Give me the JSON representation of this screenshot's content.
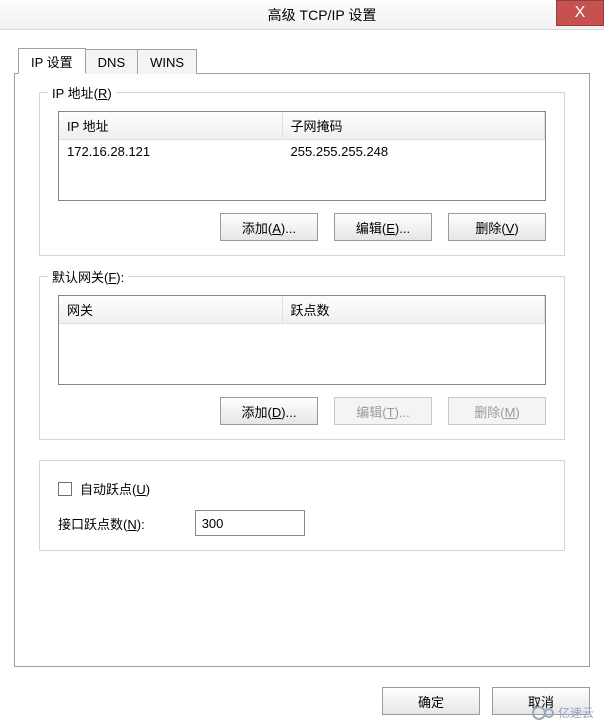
{
  "window": {
    "title": "高级 TCP/IP 设置",
    "close": "X"
  },
  "tabs": [
    "IP 设置",
    "DNS",
    "WINS"
  ],
  "ip_group": {
    "legend_pre": "IP 地址(",
    "legend_key": "R",
    "legend_post": ")",
    "cols": [
      "IP 地址",
      "子网掩码"
    ],
    "rows": [
      {
        "ip": "172.16.28.121",
        "mask": "255.255.255.248"
      }
    ],
    "btn_add_pre": "添加(",
    "btn_add_key": "A",
    "btn_add_post": ")...",
    "btn_edit_pre": "编辑(",
    "btn_edit_key": "E",
    "btn_edit_post": ")...",
    "btn_del_pre": "删除(",
    "btn_del_key": "V",
    "btn_del_post": ")"
  },
  "gw_group": {
    "legend_pre": "默认网关(",
    "legend_key": "F",
    "legend_post": "):",
    "cols": [
      "网关",
      "跃点数"
    ],
    "rows": [],
    "btn_add_pre": "添加(",
    "btn_add_key": "D",
    "btn_add_post": ")...",
    "btn_edit_pre": "编辑(",
    "btn_edit_key": "T",
    "btn_edit_post": ")...",
    "btn_del_pre": "删除(",
    "btn_del_key": "M",
    "btn_del_post": ")"
  },
  "metric": {
    "auto_label_pre": "自动跃点(",
    "auto_label_key": "U",
    "auto_label_post": ")",
    "auto_checked": false,
    "iface_label_pre": "接口跃点数(",
    "iface_label_key": "N",
    "iface_label_post": "):",
    "iface_value": "300"
  },
  "buttons": {
    "ok": "确定",
    "cancel": "取消"
  },
  "watermark": "亿速云"
}
